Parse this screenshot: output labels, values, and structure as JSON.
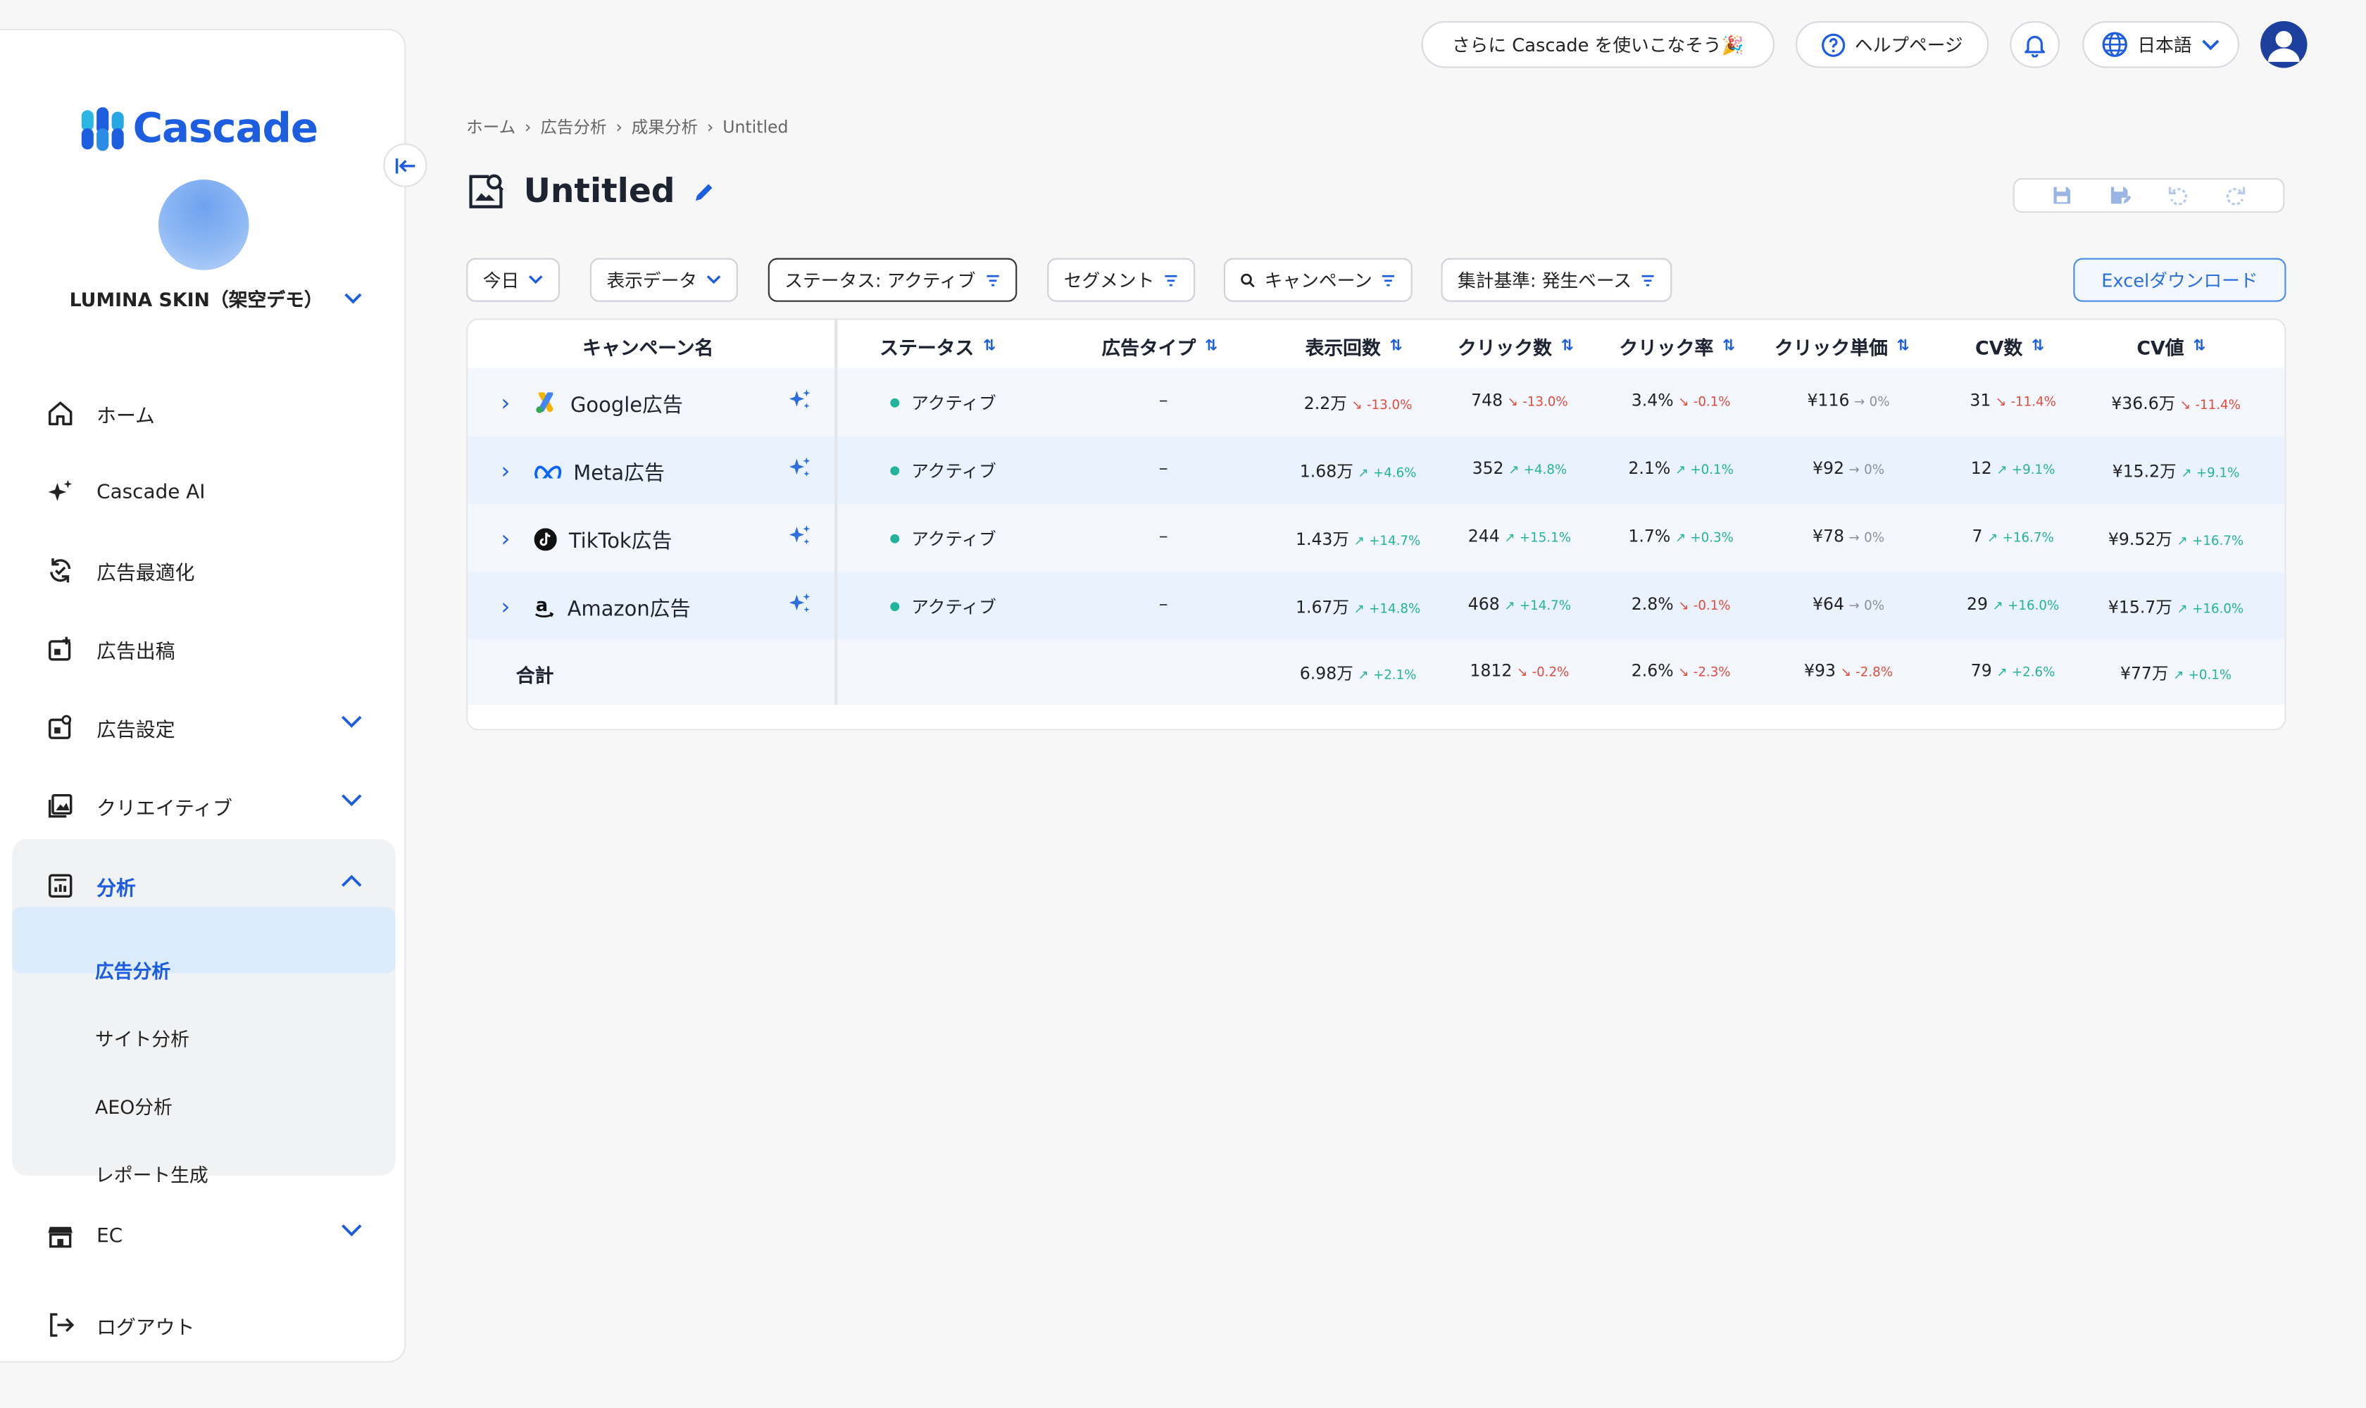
{
  "app": {
    "logo_text": "Cascade",
    "workspace_name": "LUMINA SKIN（架空デモ）",
    "brand_color": "#1d5de0"
  },
  "header": {
    "promo_label": "さらに Cascade を使いこなそう🎉",
    "help_label": "ヘルプページ",
    "language_label": "日本語"
  },
  "sidebar": {
    "items": [
      {
        "label": "ホーム",
        "icon": "home-icon"
      },
      {
        "label": "Cascade AI",
        "icon": "sparkle-icon"
      },
      {
        "label": "広告最適化",
        "icon": "refresh-check-icon"
      },
      {
        "label": "広告出稿",
        "icon": "ad-publish-icon"
      },
      {
        "label": "広告設定",
        "icon": "ad-settings-icon"
      },
      {
        "label": "クリエイティブ",
        "icon": "image-gallery-icon"
      },
      {
        "label": "分析",
        "icon": "analytics-icon"
      },
      {
        "label": "EC",
        "icon": "store-icon"
      },
      {
        "label": "ログアウト",
        "icon": "logout-icon"
      }
    ],
    "analysis_sub": [
      "広告分析",
      "サイト分析",
      "AEO分析",
      "レポート生成"
    ]
  },
  "breadcrumb": [
    "ホーム",
    "広告分析",
    "成果分析",
    "Untitled"
  ],
  "page": {
    "title": "Untitled"
  },
  "filters": {
    "date": "今日",
    "display": "表示データ",
    "status": "ステータス: アクティブ",
    "segment": "セグメント",
    "campaign": "キャンペーン",
    "basis": "集計基準: 発生ベース",
    "excel": "Excelダウンロード"
  },
  "table": {
    "columns": [
      "キャンペーン名",
      "ステータス",
      "広告タイプ",
      "表示回数",
      "クリック数",
      "クリック率",
      "クリック単価",
      "CV数",
      "CV値"
    ],
    "rows": [
      {
        "name": "Google広告",
        "icon": "google-ads-icon",
        "status": "アクティブ",
        "type": "–",
        "impressions": "2.2万",
        "impressions_delta": "-13.0%",
        "impressions_dir": "down",
        "clicks": "748",
        "clicks_delta": "-13.0%",
        "clicks_dir": "down",
        "ctr": "3.4%",
        "ctr_delta": "-0.1%",
        "ctr_dir": "down",
        "cpc": "¥116",
        "cpc_delta": "0%",
        "cpc_dir": "flat",
        "cv": "31",
        "cv_delta": "-11.4%",
        "cv_dir": "down",
        "cv_value": "¥36.6万",
        "cv_value_delta": "-11.4%",
        "cv_value_dir": "down"
      },
      {
        "name": "Meta広告",
        "icon": "meta-icon",
        "status": "アクティブ",
        "type": "–",
        "impressions": "1.68万",
        "impressions_delta": "+4.6%",
        "impressions_dir": "up",
        "clicks": "352",
        "clicks_delta": "+4.8%",
        "clicks_dir": "up",
        "ctr": "2.1%",
        "ctr_delta": "+0.1%",
        "ctr_dir": "up",
        "cpc": "¥92",
        "cpc_delta": "0%",
        "cpc_dir": "flat",
        "cv": "12",
        "cv_delta": "+9.1%",
        "cv_dir": "up",
        "cv_value": "¥15.2万",
        "cv_value_delta": "+9.1%",
        "cv_value_dir": "up"
      },
      {
        "name": "TikTok広告",
        "icon": "tiktok-icon",
        "status": "アクティブ",
        "type": "–",
        "impressions": "1.43万",
        "impressions_delta": "+14.7%",
        "impressions_dir": "up",
        "clicks": "244",
        "clicks_delta": "+15.1%",
        "clicks_dir": "up",
        "ctr": "1.7%",
        "ctr_delta": "+0.3%",
        "ctr_dir": "up",
        "cpc": "¥78",
        "cpc_delta": "0%",
        "cpc_dir": "flat",
        "cv": "7",
        "cv_delta": "+16.7%",
        "cv_dir": "up",
        "cv_value": "¥9.52万",
        "cv_value_delta": "+16.7%",
        "cv_value_dir": "up"
      },
      {
        "name": "Amazon広告",
        "icon": "amazon-icon",
        "status": "アクティブ",
        "type": "–",
        "impressions": "1.67万",
        "impressions_delta": "+14.8%",
        "impressions_dir": "up",
        "clicks": "468",
        "clicks_delta": "+14.7%",
        "clicks_dir": "up",
        "ctr": "2.8%",
        "ctr_delta": "-0.1%",
        "ctr_dir": "down",
        "cpc": "¥64",
        "cpc_delta": "0%",
        "cpc_dir": "flat",
        "cv": "29",
        "cv_delta": "+16.0%",
        "cv_dir": "up",
        "cv_value": "¥15.7万",
        "cv_value_delta": "+16.0%",
        "cv_value_dir": "up"
      }
    ],
    "total": {
      "name": "合計",
      "impressions": "6.98万",
      "impressions_delta": "+2.1%",
      "impressions_dir": "up",
      "clicks": "1812",
      "clicks_delta": "-0.2%",
      "clicks_dir": "down",
      "ctr": "2.6%",
      "ctr_delta": "-2.3%",
      "ctr_dir": "down",
      "cpc": "¥93",
      "cpc_delta": "-2.8%",
      "cpc_dir": "down",
      "cv": "79",
      "cv_delta": "+2.6%",
      "cv_dir": "up",
      "cv_value": "¥77万",
      "cv_value_delta": "+0.1%",
      "cv_value_dir": "up"
    }
  }
}
